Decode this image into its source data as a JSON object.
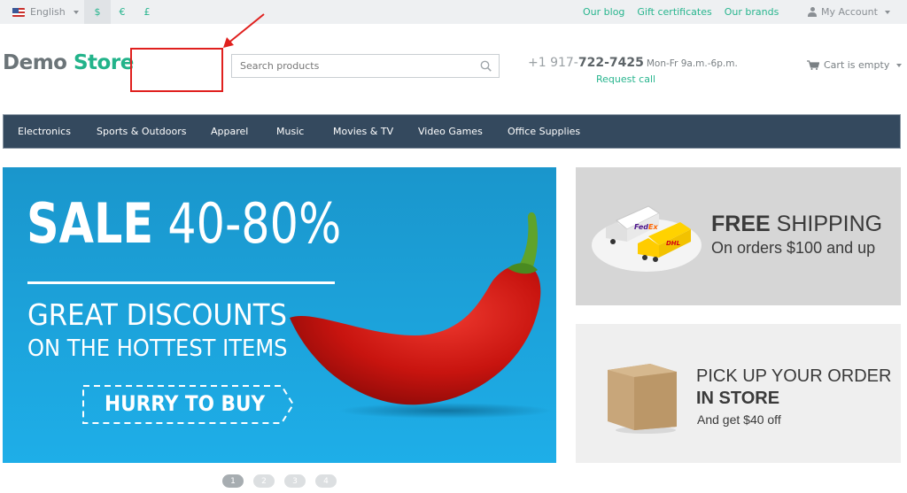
{
  "topbar": {
    "language": "English",
    "currencies": [
      {
        "symbol": "$",
        "active": true
      },
      {
        "symbol": "€",
        "active": false
      },
      {
        "symbol": "£",
        "active": false
      }
    ],
    "links": [
      "Our blog",
      "Gift certificates",
      "Our brands"
    ],
    "account_label": "My Account"
  },
  "header": {
    "logo_part1": "Demo",
    "logo_part2": "Store",
    "search_placeholder": "Search products",
    "phone_prefix": "+1 917-",
    "phone_main": "722-7425",
    "hours": "Mon-Fr 9a.m.-6p.m.",
    "request_call": "Request call",
    "cart_label": "Cart is empty"
  },
  "nav": {
    "items": [
      "Electronics",
      "Sports & Outdoors",
      "Apparel",
      "Music",
      "Movies & TV",
      "Video Games",
      "Office Supplies"
    ]
  },
  "hero": {
    "sale_bold": "SALE",
    "sale_range": "40-80%",
    "line1": "GREAT DISCOUNTS",
    "line2": "ON THE HOTTEST ITEMS",
    "cta": "HURRY TO BUY"
  },
  "banners": {
    "shipping_bold": "FREE",
    "shipping_rest": "SHIPPING",
    "shipping_sub": "On orders $100 and up",
    "pickup_line1": "PICK UP YOUR ORDER",
    "pickup_line2": "IN STORE",
    "pickup_line3": "And get $40 off"
  },
  "carousel": {
    "pages": [
      "1",
      "2",
      "3",
      "4"
    ],
    "active_page": "1"
  },
  "colors": {
    "accent": "#28b58e",
    "nav_bg": "#34495e",
    "annotation": "#e0201e"
  }
}
